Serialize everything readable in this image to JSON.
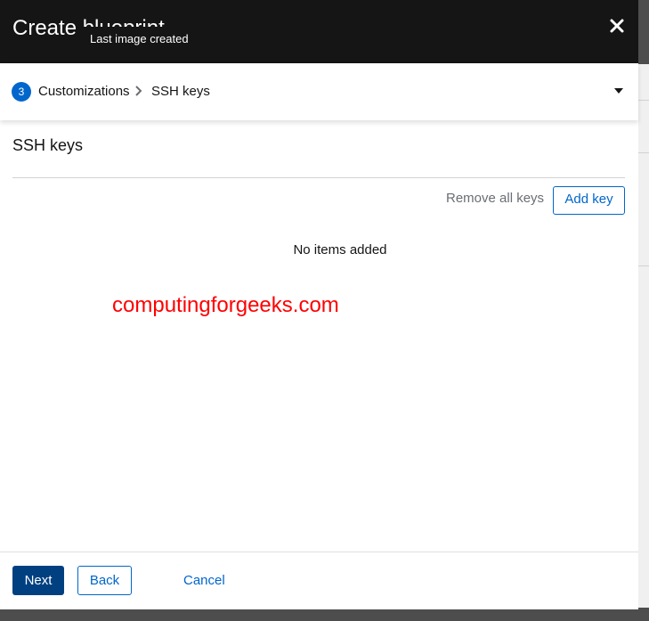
{
  "modal": {
    "title": "Create blueprint",
    "tooltip": "Last image created",
    "close_icon": "close-icon"
  },
  "wizard_nav": {
    "step_number": "3",
    "step_label": "Customizations",
    "substep_label": "SSH keys"
  },
  "ssh_keys": {
    "title": "SSH keys",
    "remove_all_label": "Remove all keys",
    "add_key_label": "Add key",
    "empty_text": "No items added"
  },
  "watermark": "computingforgeeks.com",
  "footer": {
    "next_label": "Next",
    "back_label": "Back",
    "cancel_label": "Cancel"
  },
  "colors": {
    "header_bg": "#151515",
    "primary": "#0066cc",
    "primary_dark": "#004080",
    "watermark": "#ff0000",
    "secondary_text": "#6a6e73"
  }
}
